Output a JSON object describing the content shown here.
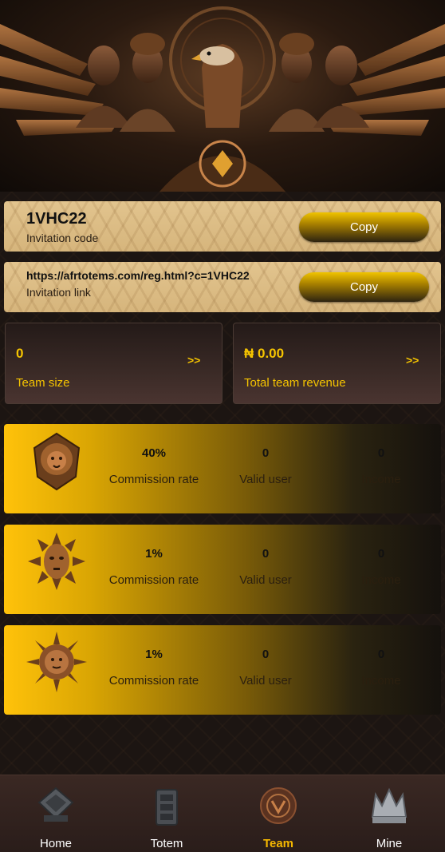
{
  "invitation": {
    "code": "1VHC22",
    "code_label": "Invitation code",
    "link": "https://afrtotems.com/reg.html?c=1VHC22",
    "link_label": "Invitation link",
    "copy_label": "Copy"
  },
  "stats": {
    "team_size_value": "0",
    "team_size_label": "Team size",
    "revenue_value": "₦ 0.00",
    "revenue_label": "Total team revenue",
    "arrow": ">>"
  },
  "tiers": [
    {
      "emblem": "lion-emblem-icon",
      "commission": "40%",
      "commission_label": "Commission rate",
      "valid_users": "0",
      "valid_label": "Valid user",
      "income": "0",
      "income_label": "Income"
    },
    {
      "emblem": "mask-emblem-icon",
      "commission": "1%",
      "commission_label": "Commission rate",
      "valid_users": "0",
      "valid_label": "Valid user",
      "income": "0",
      "income_label": "Income"
    },
    {
      "emblem": "sun-face-emblem-icon",
      "commission": "1%",
      "commission_label": "Commission rate",
      "valid_users": "0",
      "valid_label": "Valid user",
      "income": "0",
      "income_label": "Income"
    }
  ],
  "nav": [
    {
      "label": "Home",
      "icon": "home-icon"
    },
    {
      "label": "Totem",
      "icon": "totem-icon"
    },
    {
      "label": "Team",
      "icon": "team-icon",
      "active": true
    },
    {
      "label": "Mine",
      "icon": "crown-icon"
    }
  ],
  "colors": {
    "accent": "#f5c400",
    "nav_active": "#f5b800",
    "background": "#1c1512"
  }
}
